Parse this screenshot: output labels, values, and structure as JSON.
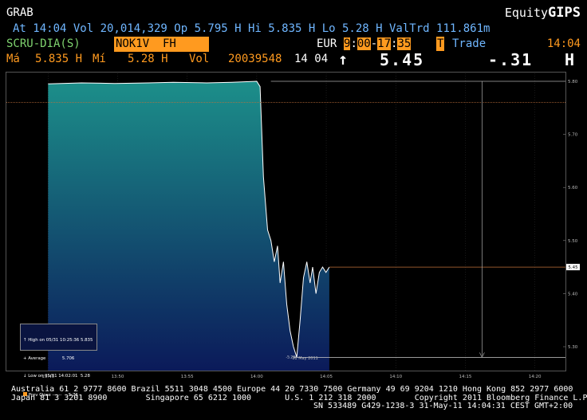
{
  "header": {
    "title": "GRAB",
    "brand_prefix": "Equity",
    "brand_suffix": "GIPS",
    "summary": "At 14:04 Vol 20,014,329 Op 5.795 H Hi 5.835 H Lo 5.28 H ValTrd 111.861m"
  },
  "row2": {
    "source": "SCRU-DIA(S)",
    "ticker": "NOK1V  FH",
    "currency": "EUR",
    "open_h": "9",
    "open_m": "00",
    "close_h": "17",
    "close_m": "35",
    "mode_flag": "T",
    "mode_label": "Trade",
    "time": "14:04"
  },
  "row3": {
    "hi_label": "Má",
    "hi_value": "5.835 H",
    "lo_label": "Mí",
    "lo_value": "5.28 H",
    "vol_label": "Vol",
    "vol_value": "20039548",
    "time_h": "14",
    "time_m": "04",
    "arrow": "↑",
    "last": "5.45",
    "change": "-.31",
    "flag": "H"
  },
  "legend": {
    "high": "High on 05/31 10:25:36 5.835",
    "average": "Average            5.706",
    "low": "Low on 05/31 14:02:01  5.28",
    "prev_close": "Prev Close ------     5.76"
  },
  "chart_data": {
    "type": "area",
    "title": "",
    "xlabel": "31 May 2011",
    "ylabel": "",
    "x_ticks": [
      "13:45",
      "13:50",
      "13:55",
      "14:00",
      "14:05",
      "14:10",
      "14:15",
      "14:20"
    ],
    "y_ticks": [
      "5.80",
      "5.70",
      "5.60",
      "5.50",
      "5.40",
      "5.30"
    ],
    "ylim": [
      5.255,
      5.815
    ],
    "current_price_label": "5.45",
    "low_label": "5.28",
    "prev_close": 5.76,
    "high": 5.8,
    "current": 5.45,
    "low": 5.28,
    "series": [
      {
        "values": [
          [
            13.75,
            5.795
          ],
          [
            13.79,
            5.797
          ],
          [
            13.83,
            5.796
          ],
          [
            13.87,
            5.797
          ],
          [
            13.9,
            5.798
          ],
          [
            13.94,
            5.797
          ],
          [
            13.97,
            5.798
          ],
          [
            14.0,
            5.8
          ],
          [
            14.004,
            5.79
          ],
          [
            14.008,
            5.62
          ],
          [
            14.013,
            5.52
          ],
          [
            14.017,
            5.5
          ],
          [
            14.021,
            5.46
          ],
          [
            14.025,
            5.49
          ],
          [
            14.028,
            5.42
          ],
          [
            14.032,
            5.46
          ],
          [
            14.036,
            5.38
          ],
          [
            14.04,
            5.33
          ],
          [
            14.044,
            5.3
          ],
          [
            14.048,
            5.28
          ],
          [
            14.052,
            5.35
          ],
          [
            14.056,
            5.43
          ],
          [
            14.06,
            5.46
          ],
          [
            14.064,
            5.42
          ],
          [
            14.067,
            5.45
          ],
          [
            14.071,
            5.4
          ],
          [
            14.075,
            5.44
          ],
          [
            14.079,
            5.45
          ],
          [
            14.083,
            5.44
          ],
          [
            14.087,
            5.45
          ]
        ]
      }
    ],
    "colors": {
      "area_top": "#1c8f8a",
      "area_bottom": "#0b1a5a",
      "line": "#ffffff",
      "prev_close": "#c0703a",
      "current": "#c0703a",
      "low": "#cccccc"
    }
  },
  "footer": {
    "line1": "Australia 61 2 9777 8600 Brazil 5511 3048 4500 Europe 44 20 7330 7500 Germany 49 69 9204 1210 Hong Kong 852 2977 6000",
    "line2": "Japan 81 3 3201 8900        Singapore 65 6212 1000       U.S. 1 212 318 2000        Copyright 2011 Bloomberg Finance L.P.",
    "line3": "SN 533489 G429-1238-3 31-May-11 14:04:31 CEST GMT+2:00"
  }
}
